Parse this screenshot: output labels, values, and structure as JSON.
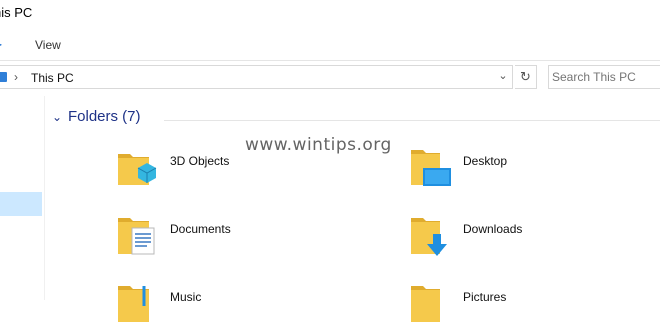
{
  "window": {
    "title": "his PC"
  },
  "ribbon": {
    "file_glyph": "▸",
    "view_label": "View"
  },
  "address_bar": {
    "separator": "›",
    "path": "This PC",
    "dropdown_glyph": "⌄",
    "refresh_glyph": "↻"
  },
  "search": {
    "placeholder": "Search This PC"
  },
  "content": {
    "group_chevron": "⌄",
    "group_title": "Folders (7)",
    "folders": [
      {
        "label": "3D Objects",
        "icon": "3d-objects-folder-icon"
      },
      {
        "label": "Desktop",
        "icon": "desktop-folder-icon"
      },
      {
        "label": "Documents",
        "icon": "documents-folder-icon"
      },
      {
        "label": "Downloads",
        "icon": "downloads-folder-icon"
      },
      {
        "label": "Music",
        "icon": "music-folder-icon"
      },
      {
        "label": "Pictures",
        "icon": "pictures-folder-icon"
      }
    ]
  },
  "watermark": "www.wintips.org",
  "colors": {
    "accent": "#1e3287",
    "folder": "#f5c94b",
    "folder_dark": "#e0ac2e",
    "selection": "#cce8ff"
  }
}
